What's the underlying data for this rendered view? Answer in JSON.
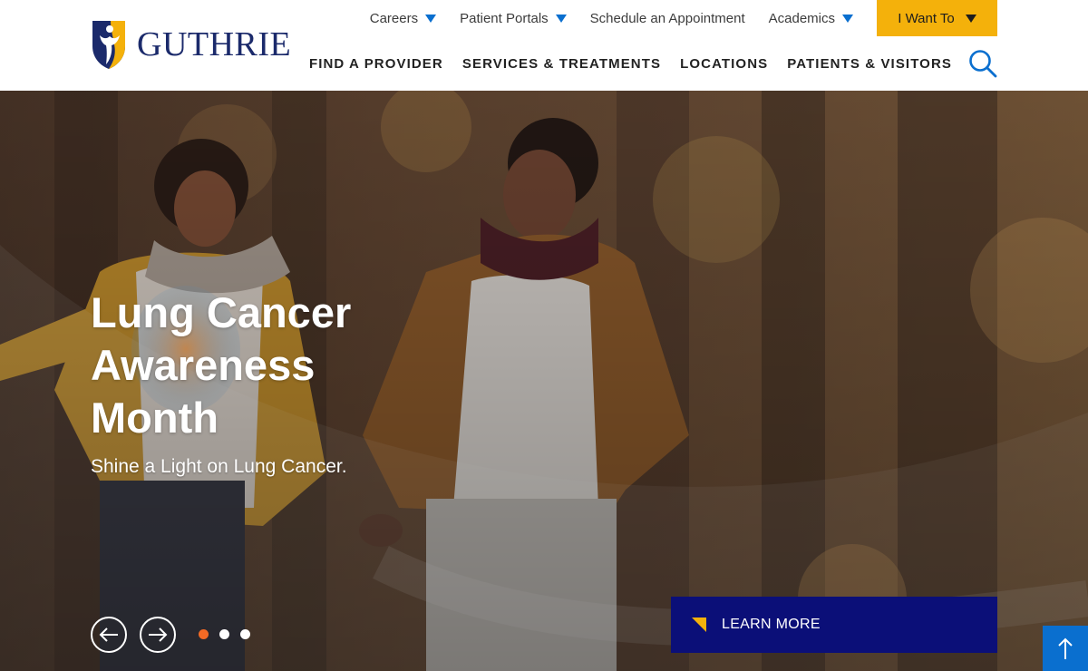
{
  "header": {
    "logo": {
      "text": "GUTHRIE"
    },
    "utility_nav": [
      {
        "label": "Careers",
        "has_dropdown": true
      },
      {
        "label": "Patient Portals",
        "has_dropdown": true
      },
      {
        "label": "Schedule an Appointment",
        "has_dropdown": false
      },
      {
        "label": "Academics",
        "has_dropdown": true
      }
    ],
    "i_want_to": {
      "label": "I Want To",
      "icon": "caret-down-icon"
    },
    "main_nav": [
      {
        "label": "FIND A PROVIDER"
      },
      {
        "label": "SERVICES & TREATMENTS"
      },
      {
        "label": "LOCATIONS"
      },
      {
        "label": "PATIENTS & VISITORS"
      }
    ],
    "search": {
      "icon": "search-icon"
    }
  },
  "hero": {
    "title": "Lung Cancer Awareness Month",
    "subtitle": "Shine a Light on Lung Cancer.",
    "cta": {
      "label": "LEARN MORE",
      "icon": "corner-triangle-icon"
    },
    "carousel": {
      "slide_count": 3,
      "active_index": 0,
      "prev_icon": "arrow-left-icon",
      "next_icon": "arrow-right-icon"
    }
  },
  "back_to_top": {
    "icon": "arrow-up-icon"
  },
  "colors": {
    "brand_navy": "#1b2a6b",
    "brand_gold": "#f4b10b",
    "link_blue": "#0a6fcf",
    "cta_navy": "#0b0f78",
    "dot_active": "#f26a25"
  }
}
